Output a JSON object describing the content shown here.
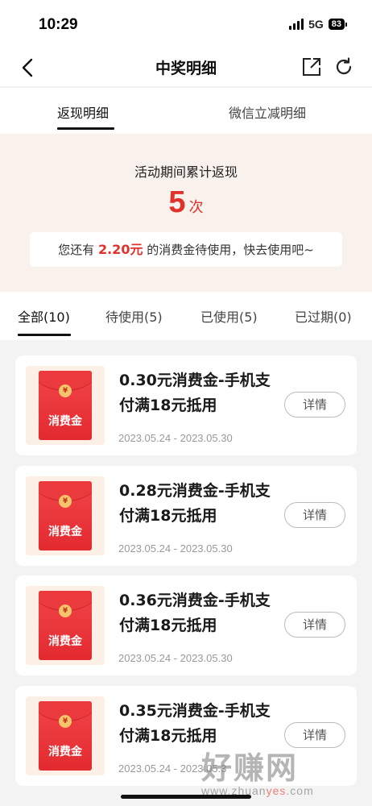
{
  "status_bar": {
    "time": "10:29",
    "network": "5G",
    "battery": "83"
  },
  "nav": {
    "title": "中奖明细",
    "back_icon": "chevron-left-icon",
    "share_icon": "share-icon",
    "refresh_icon": "refresh-icon"
  },
  "top_tabs": [
    {
      "label": "返现明细",
      "active": true
    },
    {
      "label": "微信立减明细",
      "active": false
    }
  ],
  "summary": {
    "label": "活动期间累计返现",
    "count": "5",
    "count_unit": "次",
    "note_prefix": "您还有",
    "note_amount": "2.20元",
    "note_suffix": "的消费金待使用，快去使用吧~"
  },
  "filter_tabs": [
    {
      "label": "全部(10)",
      "active": true
    },
    {
      "label": "待使用(5)",
      "active": false
    },
    {
      "label": "已使用(5)",
      "active": false
    },
    {
      "label": "已过期(0)",
      "active": false
    }
  ],
  "coupons": [
    {
      "title": "0.30元消费金-手机支付满18元抵用",
      "date": "2023.05.24 - 2023.05.30",
      "thumb_label": "消费金",
      "button": "详情"
    },
    {
      "title": "0.28元消费金-手机支付满18元抵用",
      "date": "2023.05.24 - 2023.05.30",
      "thumb_label": "消费金",
      "button": "详情"
    },
    {
      "title": "0.36元消费金-手机支付满18元抵用",
      "date": "2023.05.24 - 2023.05.30",
      "thumb_label": "消费金",
      "button": "详情"
    },
    {
      "title": "0.35元消费金-手机支付满18元抵用",
      "date": "2023.05.24 - 2023.05.3",
      "thumb_label": "消费金",
      "button": "详情"
    }
  ],
  "watermark": {
    "text": "好赚网",
    "url_a": "www.zhuan",
    "url_b": "yes",
    "url_c": ".com"
  },
  "colors": {
    "accent_red": "#e0312b",
    "summary_bg": "#f8f1ec"
  }
}
